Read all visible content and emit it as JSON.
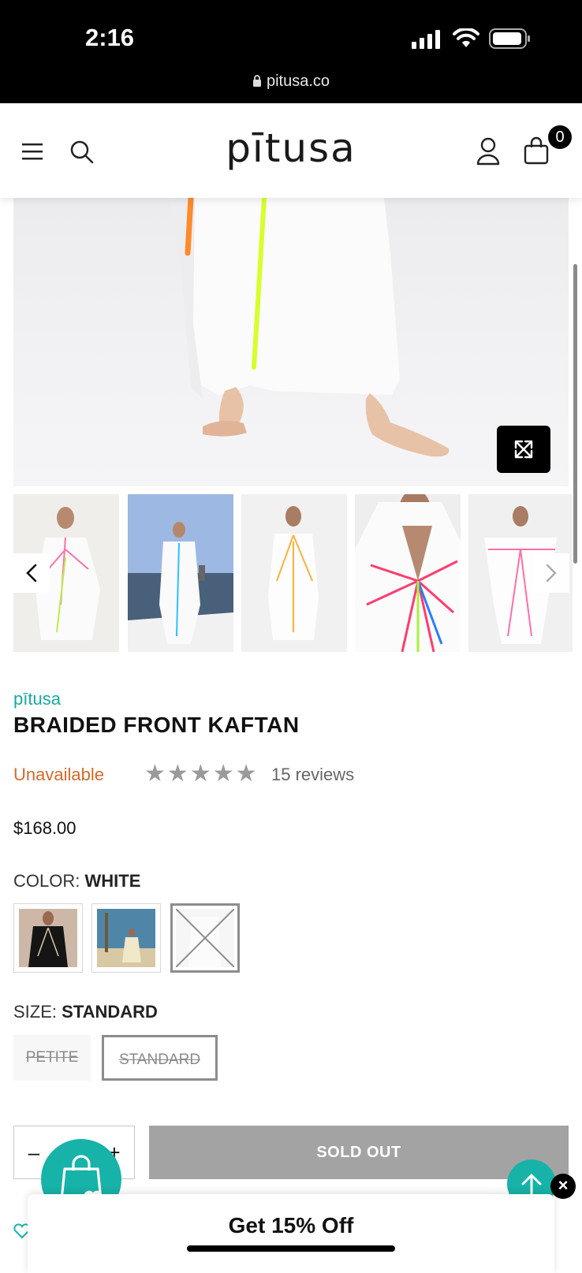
{
  "status_bar": {
    "time": "2:16",
    "url": "pitusa.co"
  },
  "header": {
    "logo": "pītusa",
    "cart_count": "0"
  },
  "gallery": {
    "thumbnail_count": 5
  },
  "product": {
    "brand": "pītusa",
    "title": "BRAIDED FRONT KAFTAN",
    "availability": "Unavailable",
    "rating_stars": 5,
    "reviews": "15 reviews",
    "price": "$168.00"
  },
  "color_option": {
    "label": "COLOR:",
    "selected": "WHITE",
    "swatches": [
      "black",
      "sand",
      "white"
    ]
  },
  "size_option": {
    "label": "SIZE:",
    "selected": "STANDARD",
    "sizes": [
      "PETITE",
      "STANDARD"
    ]
  },
  "quantity": {
    "minus": "–",
    "plus": "+"
  },
  "buttons": {
    "sold_out": "SOLD OUT"
  },
  "popup": {
    "text": "Get 15% Off"
  },
  "colors": {
    "teal": "#17b3a8",
    "unavailable": "#d46a2a",
    "soldout_bg": "#a3a3a3"
  },
  "icons": [
    "signal-icon",
    "wifi-icon",
    "battery-icon",
    "lock-icon",
    "menu-icon",
    "search-icon",
    "account-icon",
    "cart-icon",
    "expand-icon",
    "chevron-left-icon",
    "chevron-right-icon",
    "star-icon",
    "shopping-bag-heart-icon",
    "arrow-up-icon",
    "close-icon",
    "heart-icon"
  ]
}
